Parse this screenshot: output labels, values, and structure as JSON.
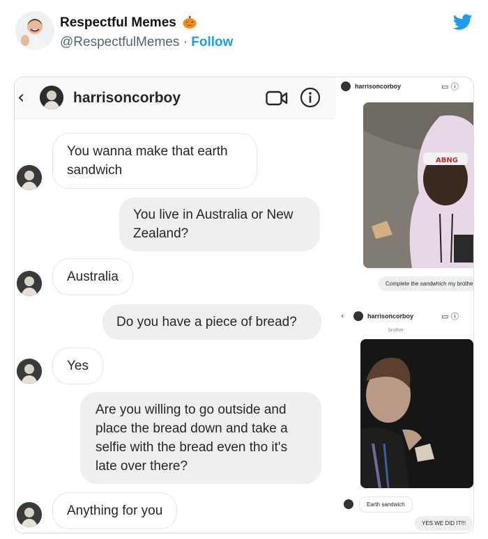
{
  "tweet": {
    "name": "Respectful Memes",
    "handle": "@RespectfulMemes",
    "separator": " · ",
    "follow_label": "Follow"
  },
  "chat": {
    "username": "harrisoncorboy",
    "messages": [
      {
        "from": "them",
        "text": "You wanna make that earth sandwich"
      },
      {
        "from": "me",
        "text": "You live in Australia or New Zealand?"
      },
      {
        "from": "them",
        "text": "Australia"
      },
      {
        "from": "me",
        "text": "Do you have a piece of bread?"
      },
      {
        "from": "them",
        "text": "Yes"
      },
      {
        "from": "me",
        "text": "Are you willing to go outside and place the bread down and take a selfie with the bread even tho it's late over there?"
      },
      {
        "from": "them",
        "text": "Anything for you"
      }
    ]
  },
  "side": {
    "top_username": "harrisoncorboy",
    "caption1": "Complete the sandwhich my brother",
    "second_username": "harrisoncorboy",
    "caption_partial": "brother",
    "caption2": "Earth sandwich",
    "reply": "YES WE DID IT!!!",
    "headband_text": "ABNG"
  },
  "colors": {
    "link": "#1d9bf0",
    "text": "#262626",
    "muted": "#536471",
    "hoodie": "#e8d7e6"
  }
}
